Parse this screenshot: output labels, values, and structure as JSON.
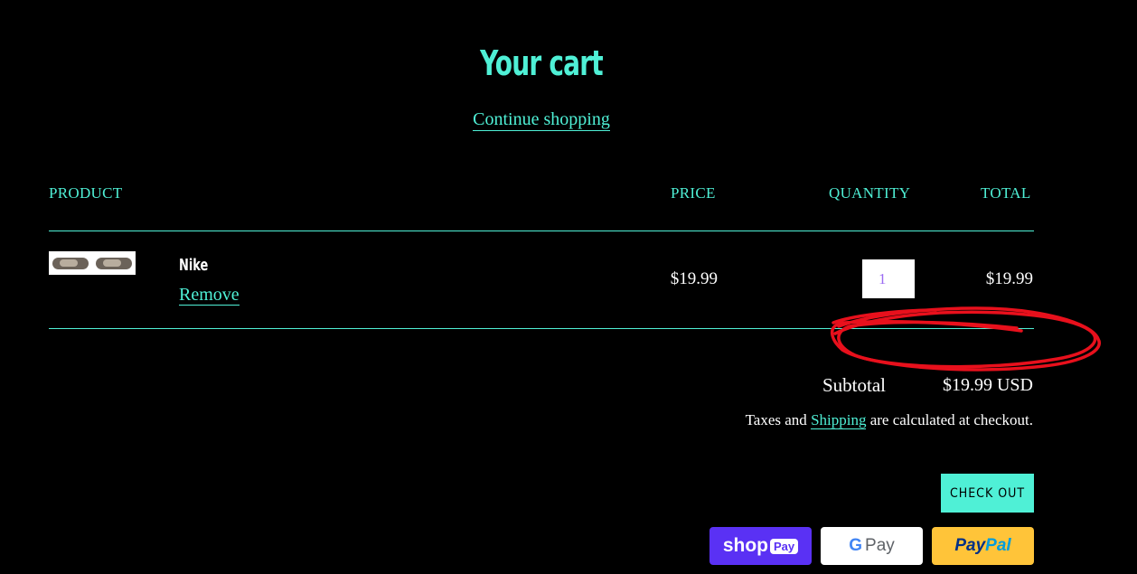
{
  "page": {
    "title": "Your cart",
    "continue_label": "Continue shopping"
  },
  "table": {
    "headers": {
      "product": "PRODUCT",
      "price": "PRICE",
      "quantity": "QUANTITY",
      "total": "TOTAL"
    }
  },
  "item": {
    "name": "Nike",
    "remove_label": "Remove",
    "price": "$19.99",
    "quantity": "1",
    "total": "$19.99"
  },
  "summary": {
    "subtotal_label": "Subtotal",
    "subtotal_value": "$19.99 USD",
    "taxes_before": "Taxes and ",
    "shipping_link": "Shipping",
    "taxes_after": " are calculated at checkout."
  },
  "checkout_label": "CHECK OUT",
  "payments": {
    "shoppay_text": "shop",
    "shoppay_pill": "Pay",
    "gpay_g": "G",
    "gpay_text": "Pay",
    "paypal_a": "Pay",
    "paypal_b": "Pal"
  },
  "colors": {
    "accent": "#4ff0d6",
    "background": "#000000",
    "annotation": "#e8101c"
  }
}
